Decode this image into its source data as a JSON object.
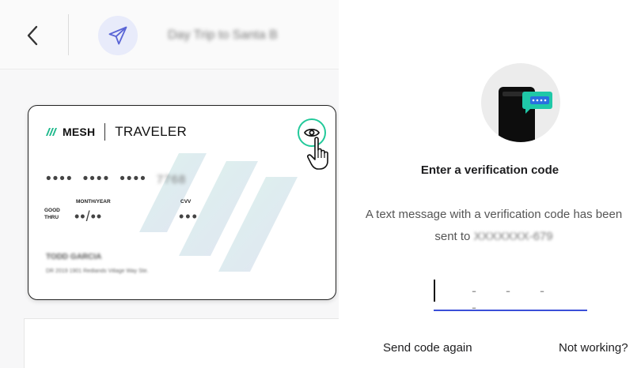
{
  "header": {
    "back_icon": "chevron-left-icon",
    "trip_icon": "airplane-icon",
    "trip_title": "Day Trip to Santa B"
  },
  "card": {
    "brand": "MESH",
    "product": "TRAVELER",
    "reveal_icon": "eye-icon",
    "pan_groups": [
      "••••",
      "••••",
      "••••"
    ],
    "pan_last4": "7768",
    "good_thru_label": "GOOD\nTHRU",
    "expiry_label": "MONTH/YEAR",
    "expiry_value": "••/••",
    "cvv_label": "CVV",
    "cvv_value": "•••",
    "holder_name": "TODD GARCIA",
    "holder_address": "DR 2019 1901 Redlands Village Way Ste."
  },
  "colors": {
    "accent_green": "#22c99a",
    "accent_blue": "#3b4fd8",
    "plane_bg": "#e8ebfa"
  },
  "verification": {
    "title": "Enter a verification code",
    "description_prefix": "A text message with a verification code has been sent to",
    "masked_phone": "XXXXXXX-679",
    "code_placeholder": "- - - -",
    "send_again": "Send code again",
    "not_working": "Not working?"
  }
}
